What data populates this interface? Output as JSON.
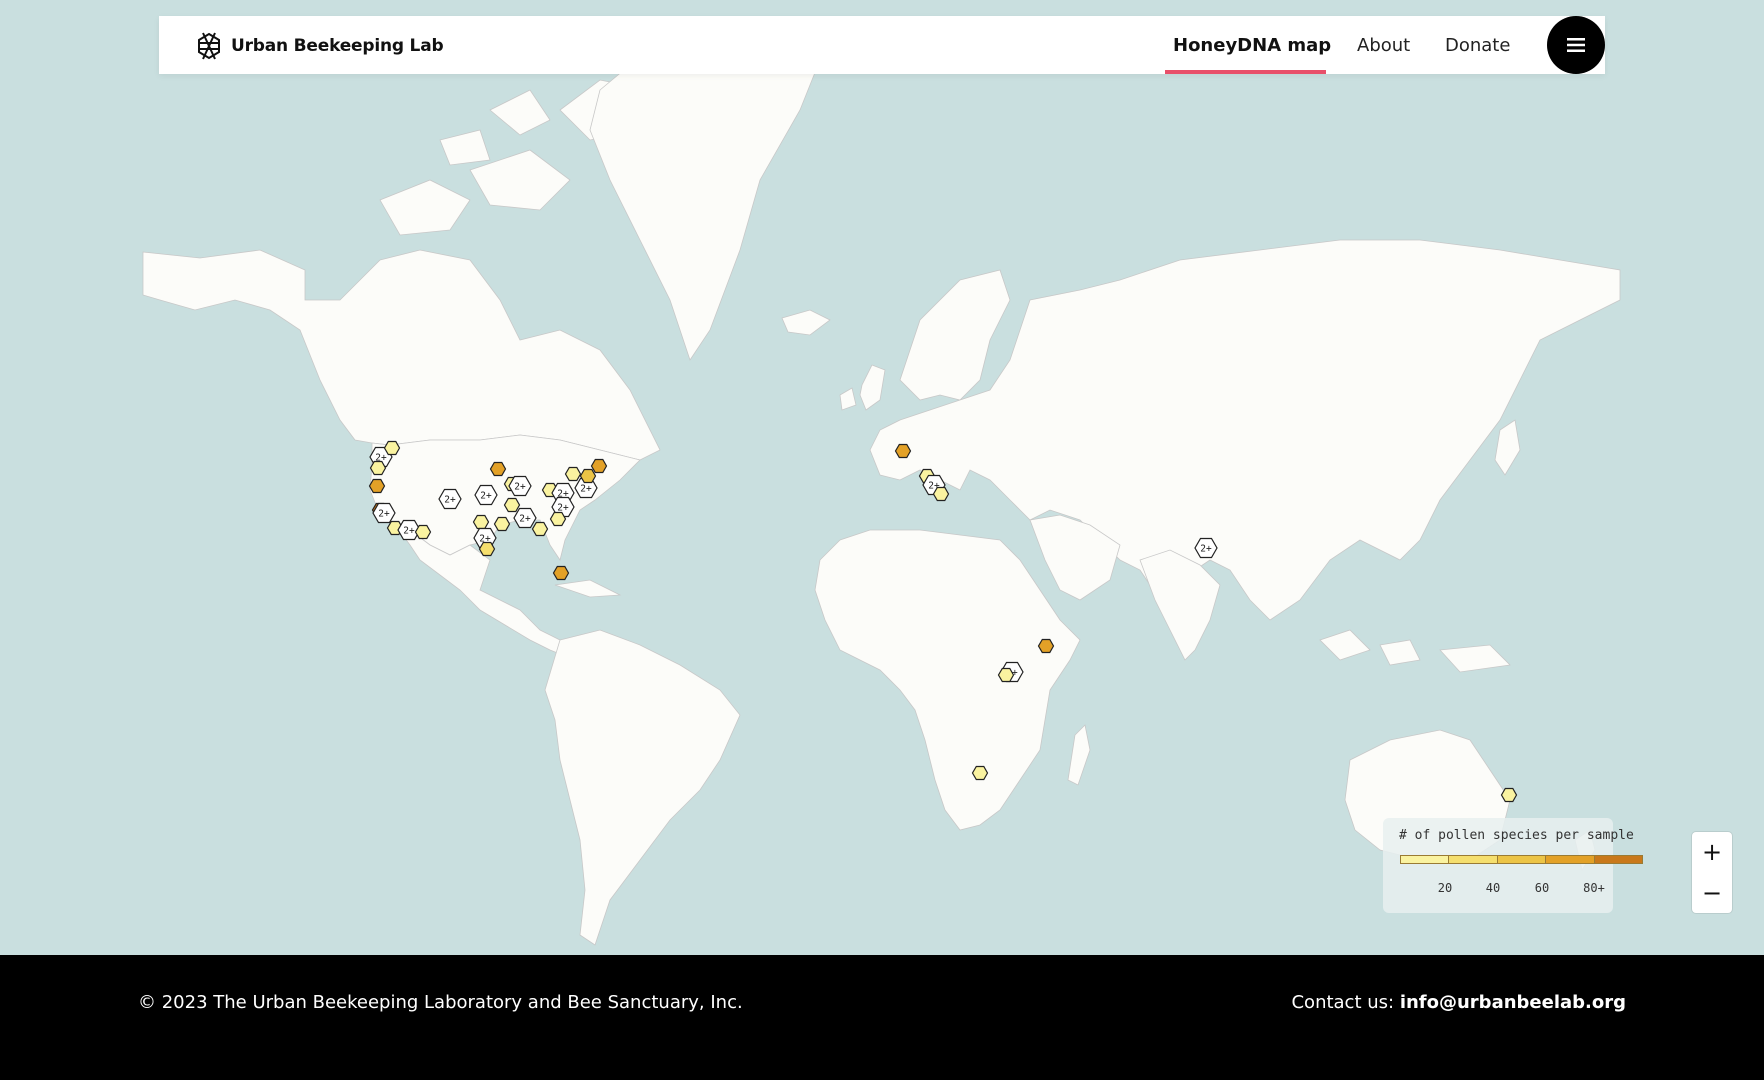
{
  "header": {
    "brand_name": "Urban Beekeeping Lab",
    "brand_icon": "hive-helix-icon",
    "nav": [
      {
        "label": "HoneyDNA map",
        "active": true
      },
      {
        "label": "About",
        "active": false
      },
      {
        "label": "Donate",
        "active": false
      }
    ],
    "menu_icon": "hamburger-icon",
    "accent_color": "#e8506a"
  },
  "map": {
    "water_color": "#c9dfdf",
    "land_color": "#fcfcf9",
    "cluster_label": "2+",
    "palette": [
      "#faf3a0",
      "#f5df6e",
      "#ecc446",
      "#e3a127",
      "#c9781a"
    ],
    "markers": [
      {
        "id": "seattle",
        "cluster": true
      },
      {
        "id": "spokane",
        "level": 1
      },
      {
        "id": "portland",
        "level": 1
      },
      {
        "id": "oregon",
        "level": 4
      },
      {
        "id": "sf",
        "level": 5
      },
      {
        "id": "sf2",
        "cluster": true
      },
      {
        "id": "la",
        "level": 1
      },
      {
        "id": "la2",
        "cluster": true
      },
      {
        "id": "sd",
        "level": 1
      },
      {
        "id": "denver",
        "cluster": true
      },
      {
        "id": "minneapolis",
        "level": 4
      },
      {
        "id": "kc",
        "cluster": true
      },
      {
        "id": "chicago",
        "level": 1
      },
      {
        "id": "chicago2",
        "cluster": true
      },
      {
        "id": "detroit",
        "level": 1
      },
      {
        "id": "cleveland",
        "level": 1
      },
      {
        "id": "pittsburgh",
        "cluster": true
      },
      {
        "id": "nyc",
        "cluster": true
      },
      {
        "id": "nyc2",
        "level": 3
      },
      {
        "id": "boston",
        "level": 4
      },
      {
        "id": "dc",
        "cluster": true
      },
      {
        "id": "stlouis",
        "level": 1
      },
      {
        "id": "nashville",
        "cluster": true
      },
      {
        "id": "atlanta",
        "level": 1
      },
      {
        "id": "charlotte",
        "level": 1
      },
      {
        "id": "dallas",
        "level": 1
      },
      {
        "id": "houston",
        "cluster": true
      },
      {
        "id": "houston2",
        "level": 2
      },
      {
        "id": "nola",
        "level": 1
      },
      {
        "id": "miami",
        "level": 4
      },
      {
        "id": "paris",
        "level": 4
      },
      {
        "id": "milan",
        "level": 1
      },
      {
        "id": "rome",
        "cluster": true
      },
      {
        "id": "naples",
        "level": 1
      },
      {
        "id": "delhi",
        "cluster": true
      },
      {
        "id": "ethiopia",
        "level": 4
      },
      {
        "id": "kampala",
        "cluster": true
      },
      {
        "id": "kampala2",
        "level": 1
      },
      {
        "id": "botswana",
        "level": 1
      },
      {
        "id": "brisbane",
        "level": 1
      }
    ]
  },
  "legend": {
    "title": "# of pollen species per sample",
    "ticks": [
      "20",
      "40",
      "60",
      "80+"
    ],
    "colors": [
      "#faf3a0",
      "#f5df6e",
      "#ecc446",
      "#e3a127",
      "#c9781a"
    ]
  },
  "zoom": {
    "in_label": "+",
    "out_label": "−"
  },
  "footer": {
    "copyright": "© 2023 The Urban Beekeeping Laboratory and Bee Sanctuary, Inc.",
    "contact_prefix": "Contact us: ",
    "email": "info@urbanbeelab.org"
  }
}
